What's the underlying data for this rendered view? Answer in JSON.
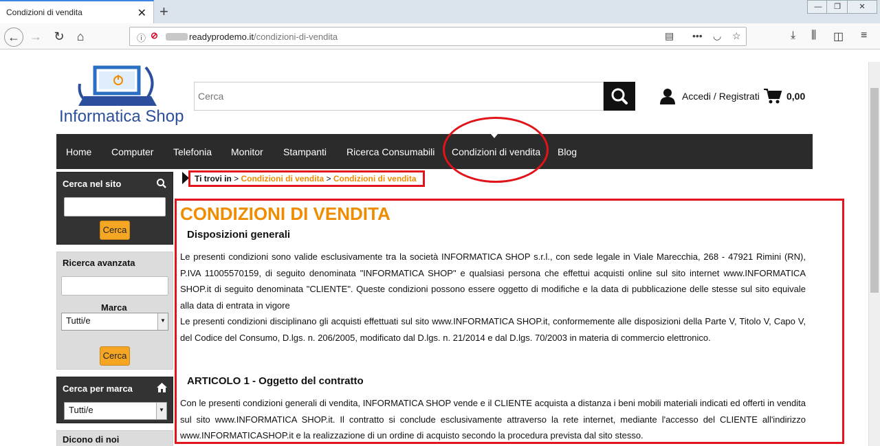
{
  "browser": {
    "tab_title": "Condizioni di vendita",
    "url_host": "readyprodemo.it",
    "url_path": "/condizioni-di-vendita"
  },
  "header": {
    "logo_text": "Informatica Shop",
    "search_placeholder": "Cerca",
    "login_label": "Accedi / Registrati",
    "cart_total": "0,00"
  },
  "menu": {
    "items": [
      "Home",
      "Computer",
      "Telefonia",
      "Monitor",
      "Stampanti",
      "Ricerca Consumabili",
      "Condizioni di vendita",
      "Blog"
    ]
  },
  "sidebar": {
    "search_title": "Cerca nel sito",
    "search_button": "Cerca",
    "advanced_title": "Ricerca avanzata",
    "brand_label": "Marca",
    "brand_selected": "Tutti/e",
    "advanced_button": "Cerca",
    "by_brand_title": "Cerca per marca",
    "by_brand_selected": "Tutti/e",
    "about_title": "Dicono di noi"
  },
  "breadcrumb": {
    "label": "Ti trovi in",
    "sep1": " > ",
    "link1": "Condizioni di vendita",
    "sep2": " > ",
    "link2": "Condizioni di vendita"
  },
  "content": {
    "title": "CONDIZIONI DI VENDITA",
    "section1_heading": "Disposizioni generali",
    "para1": "Le presenti condizioni sono valide esclusivamente tra la società INFORMATICA SHOP s.r.l., con sede legale in Viale Marecchia, 268 - 47921 Rimini (RN), P.IVA 11005570159, di seguito denominata \"INFORMATICA SHOP\" e qualsiasi persona che effettui acquisti online sul sito internet www.INFORMATICA SHOP.it di seguito denominata \"CLIENTE\". Queste condizioni possono essere oggetto di modifiche e la data di pubblicazione delle stesse sul sito equivale alla data di entrata in vigore",
    "para2": "Le presenti condizioni disciplinano gli acquisti effettuati sul sito www.INFORMATICA SHOP.it, conformemente alle disposizioni della Parte V, Titolo V, Capo V, del Codice del Consumo, D.lgs. n. 206/2005, modificato dal D.lgs. n. 21/2014 e dal D.lgs. 70/2003 in materia di commercio elettronico.",
    "section2_heading": "ARTICOLO 1 - Oggetto del contratto",
    "para3": "Con le presenti condizioni generali di vendita, INFORMATICA SHOP vende e il CLIENTE acquista a distanza i beni mobili materiali indicati ed offerti in vendita sul sito www.INFORMATICA SHOP.it. Il contratto si conclude esclusivamente attraverso la rete internet, mediante l'accesso del CLIENTE all'indirizzo www.INFORMATICASHOP.it e la realizzazione di un ordine di acquisto secondo la procedura prevista dal sito stesso."
  },
  "colors": {
    "accent_orange": "#f08c00",
    "highlight_red": "#e0141a",
    "menu_bg": "#2b2b2b"
  }
}
